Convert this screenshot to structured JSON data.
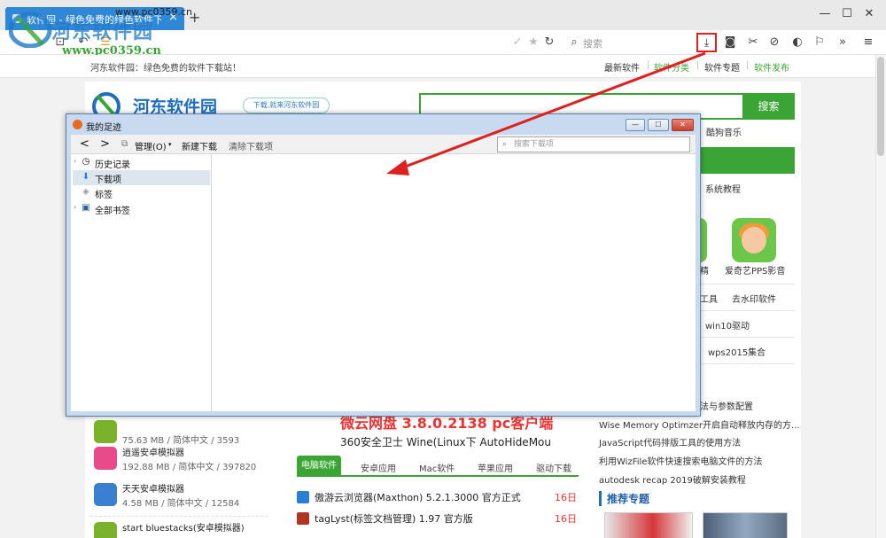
{
  "browser": {
    "tab_title": "软件园 - 绿色免费的绿色软件下载站",
    "tab_close": "×",
    "new_tab": "+",
    "url": "www.pc0359.cn",
    "search_placeholder": "搜索",
    "window_buttons": [
      "—",
      "☐",
      "✕"
    ],
    "more": "»"
  },
  "watermark": {
    "brand": "河东软件园",
    "site": "www.pc0359.cn"
  },
  "page": {
    "slogan": "河东软件园：绿色免费的软件下载站！",
    "nav": [
      {
        "label": "最新软件",
        "color": "#333333"
      },
      {
        "label": "软件分类",
        "color": "#3aa535"
      },
      {
        "label": "软件专题",
        "color": "#333333"
      },
      {
        "label": "软件发布",
        "color": "#3aa535"
      }
    ],
    "logo_text": "河东软件园",
    "tagline": "下载,就来河东软件园",
    "search_button": "搜索",
    "right_links": [
      "酷狗音乐",
      "系统教程",
      "精",
      "爱奇艺PPS影音",
      "工具",
      "去水印软件",
      "win10驱动",
      "wps2015集合"
    ],
    "headline": "微云网盘 3.8.0.2138 pc客户端",
    "subline": "360安全卫士   Wine(Linux下 AutoHideMou",
    "tabs": [
      "电脑软件",
      "安卓应用",
      "Mac软件",
      "苹果应用",
      "驱动下载"
    ],
    "soft_list": [
      {
        "title": "傲游云浏览器(Maxthon) 5.2.1.3000 官方正式",
        "date": "16日",
        "color": "#2a7ed8"
      },
      {
        "title": "tagLyst(标签文档管理) 1.97 官方版",
        "date": "16日",
        "color": "#b2331f"
      }
    ],
    "left_apps": [
      {
        "title": "",
        "meta": "75.63 MB / 简体中文 / 3593",
        "color": "#7ab32b"
      },
      {
        "title": "逍遥安卓模拟器",
        "meta": "192.88 MB / 简体中文 / 397820",
        "color": "#e94b8a"
      },
      {
        "title": "天天安卓模拟器",
        "meta": "4.58 MB / 简体中文 / 12584",
        "color": "#3a7fd0"
      },
      {
        "title": "start bluestacks(安卓模拟器)",
        "meta": "",
        "color": "#7ab32b"
      }
    ],
    "news": [
      "法与参数配置",
      "Wise Memory Optimzer开启自动释放内存的方...",
      "JavaScript代码排版工具的使用方法",
      "利用WizFile软件快速搜索电脑文件的方法",
      "autodesk recap 2019破解安装教程"
    ],
    "hot_title": "推荐专题"
  },
  "dialog": {
    "title": "我的足迹",
    "buttons": [
      "—",
      "☐",
      "✕"
    ],
    "toolbar": {
      "back": "<",
      "forward": ">",
      "manage": "管理(O)",
      "new_download": "新建下载",
      "clear": "清除下载项",
      "search_placeholder": "搜索下载项"
    },
    "sidebar": [
      {
        "label": "历史记录",
        "icon": "clock-icon",
        "glyph": "◷",
        "twisty": "›"
      },
      {
        "label": "下载项",
        "icon": "download-arrow-icon",
        "glyph": "⬇",
        "twisty": ""
      },
      {
        "label": "标签",
        "icon": "tag-icon",
        "glyph": "◈",
        "twisty": ""
      },
      {
        "label": "全部书签",
        "icon": "bookmarks-icon",
        "glyph": "▣",
        "twisty": "›"
      }
    ]
  },
  "colors": {
    "accent_green": "#3aa535",
    "tab_blue": "#2f87d8",
    "annotation_red": "#e02020"
  }
}
